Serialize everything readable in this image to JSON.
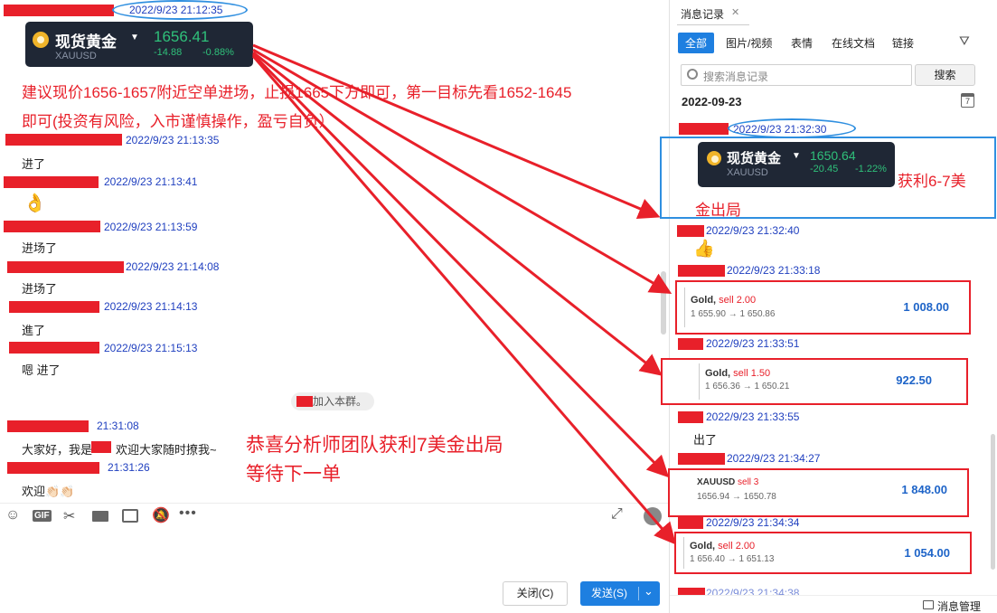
{
  "header_ts": "2022/9/23 21:12:35",
  "quote1": {
    "name": "现货黄金",
    "symbol": "XAUUSD",
    "price": "1656.41",
    "change": "-14.88",
    "pct": "-0.88%"
  },
  "advice_line1": "建议现价1656-1657附近空单进场，止损1665下方即可，第一目标先看1652-1645",
  "advice_line2": "即可(投资有风险，入市谨慎操作，盈亏自负）",
  "chat": [
    {
      "ts": "2022/9/23 21:13:35",
      "text": "进了"
    },
    {
      "ts": "2022/9/23 21:13:41",
      "text": "👌"
    },
    {
      "ts": "2022/9/23 21:13:59",
      "text": "进场了"
    },
    {
      "ts": "2022/9/23 21:14:08",
      "text": "进场了"
    },
    {
      "ts": "2022/9/23 21:14:13",
      "text": "進了"
    },
    {
      "ts": "2022/9/23 21:15:13",
      "text": "嗯 进了"
    }
  ],
  "join_notice": "加入本群。",
  "late": [
    {
      "ts": "21:31:08",
      "text_a": "大家好，我是",
      "text_b": "欢迎大家随时撩我~"
    },
    {
      "ts": "21:31:26",
      "text": "欢迎👏🏻👏🏻"
    }
  ],
  "congrats_line1": "恭喜分析师团队获利7美金出局",
  "congrats_line2": "等待下一单",
  "buttons": {
    "close": "关闭(C)",
    "send": "发送(S)",
    "send_arrow": "⌄"
  },
  "right": {
    "title": "消息记录",
    "close_x": "✕",
    "tabs": [
      "全部",
      "图片/视频",
      "表情",
      "在线文档",
      "链接"
    ],
    "search_placeholder": "搜索消息记录",
    "search_btn": "搜索",
    "date": "2022-09-23",
    "ts1": "2022/9/23 21:32:30",
    "quote2": {
      "name": "现货黄金",
      "symbol": "XAUUSD",
      "price": "1650.64",
      "change": "-20.45",
      "pct": "-1.22%"
    },
    "profit_line1": "获利6-7美",
    "profit_line2": "金出局",
    "ts2": "2022/9/23 21:32:40",
    "ts3": "2022/9/23 21:33:18",
    "trade1": {
      "label": "Gold,",
      "side": "sell 2.00",
      "prices": "1 655.90 → 1 650.86",
      "amount": "1 008.00"
    },
    "ts4": "2022/9/23 21:33:51",
    "trade2": {
      "label": "Gold,",
      "side": "sell 1.50",
      "prices": "1 656.36 → 1 650.21",
      "amount": "922.50"
    },
    "ts5": "2022/9/23 21:33:55",
    "msg_out": "出了",
    "ts6": "2022/9/23 21:34:27",
    "trade3": {
      "label": "XAUUSD",
      "side": "sell 3",
      "prices": "1656.94 → 1650.78",
      "amount": "1 848.00"
    },
    "ts7": "2022/9/23 21:34:34",
    "trade4": {
      "label": "Gold,",
      "side": "sell 2.00",
      "prices": "1 656.40 → 1 651.13",
      "amount": "1 054.00"
    },
    "ts8": "2022/9/23 21:34:38",
    "manage": "消息管理",
    "calendar_day": "7"
  },
  "colors": {
    "accent": "#1e7fe0",
    "red": "#e8202a",
    "ts_blue": "#1f3fbf"
  }
}
